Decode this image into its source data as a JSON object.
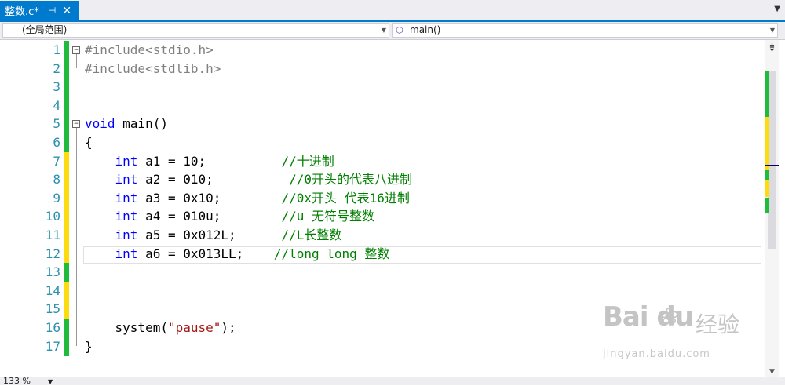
{
  "tab": {
    "title": "整数.c*",
    "pin_glyph": "⊣",
    "close_glyph": "✕",
    "overflow_glyph": "▼"
  },
  "navbar": {
    "scope": "(全局范围)",
    "member": "main()",
    "member_icon": "⬡"
  },
  "editor": {
    "line_numbers": [
      "1",
      "2",
      "3",
      "4",
      "5",
      "6",
      "7",
      "8",
      "9",
      "10",
      "11",
      "12",
      "13",
      "14",
      "15",
      "16",
      "17"
    ],
    "lines": [
      [
        {
          "c": "pp",
          "t": "#include<stdio.h>"
        }
      ],
      [
        {
          "c": "pp",
          "t": "#include<stdlib.h>"
        }
      ],
      [],
      [],
      [
        {
          "c": "kw",
          "t": "void"
        },
        {
          "c": "",
          "t": " main()"
        }
      ],
      [
        {
          "c": "",
          "t": "{"
        }
      ],
      [
        {
          "c": "",
          "t": "    "
        },
        {
          "c": "kw",
          "t": "int"
        },
        {
          "c": "",
          "t": " a1 = 10;          "
        },
        {
          "c": "cmt",
          "t": "//十进制"
        }
      ],
      [
        {
          "c": "",
          "t": "    "
        },
        {
          "c": "kw",
          "t": "int"
        },
        {
          "c": "",
          "t": " a2 = 010;          "
        },
        {
          "c": "cmt",
          "t": "//0开头的代表八进制"
        }
      ],
      [
        {
          "c": "",
          "t": "    "
        },
        {
          "c": "kw",
          "t": "int"
        },
        {
          "c": "",
          "t": " a3 = 0x10;        "
        },
        {
          "c": "cmt",
          "t": "//0x开头 代表16进制"
        }
      ],
      [
        {
          "c": "",
          "t": "    "
        },
        {
          "c": "kw",
          "t": "int"
        },
        {
          "c": "",
          "t": " a4 = 010u;        "
        },
        {
          "c": "cmt",
          "t": "//u 无符号整数"
        }
      ],
      [
        {
          "c": "",
          "t": "    "
        },
        {
          "c": "kw",
          "t": "int"
        },
        {
          "c": "",
          "t": " a5 = 0x012L;      "
        },
        {
          "c": "cmt",
          "t": "//L长整数"
        }
      ],
      [
        {
          "c": "",
          "t": "    "
        },
        {
          "c": "kw",
          "t": "int"
        },
        {
          "c": "",
          "t": " a6 = 0x013LL;    "
        },
        {
          "c": "cmt",
          "t": "//long long 整数"
        }
      ],
      [],
      [],
      [],
      [
        {
          "c": "",
          "t": "    system("
        },
        {
          "c": "str",
          "t": "\"pause\""
        },
        {
          "c": "",
          "t": ");"
        }
      ],
      [
        {
          "c": "",
          "t": "}"
        }
      ]
    ],
    "change_colors": [
      "green",
      "green",
      "green",
      "green",
      "green",
      "green",
      "yellow",
      "yellow",
      "yellow",
      "yellow",
      "yellow",
      "yellow",
      "green",
      "yellow",
      "yellow",
      "green",
      "green"
    ],
    "fold_glyph": "−"
  },
  "colors": {
    "green": "#1fbb3c",
    "yellow": "#fddc0f",
    "accent": "#007acc"
  },
  "scrollbar": {
    "split_glyph": "⇟",
    "down_glyph": "▼"
  },
  "status": {
    "zoom": "133 %",
    "zoom_arrow": "▼"
  },
  "watermark": {
    "brand": "Bai du",
    "paw": "❀",
    "sub": "jingyan.baidu.com",
    "cn": "经验"
  }
}
